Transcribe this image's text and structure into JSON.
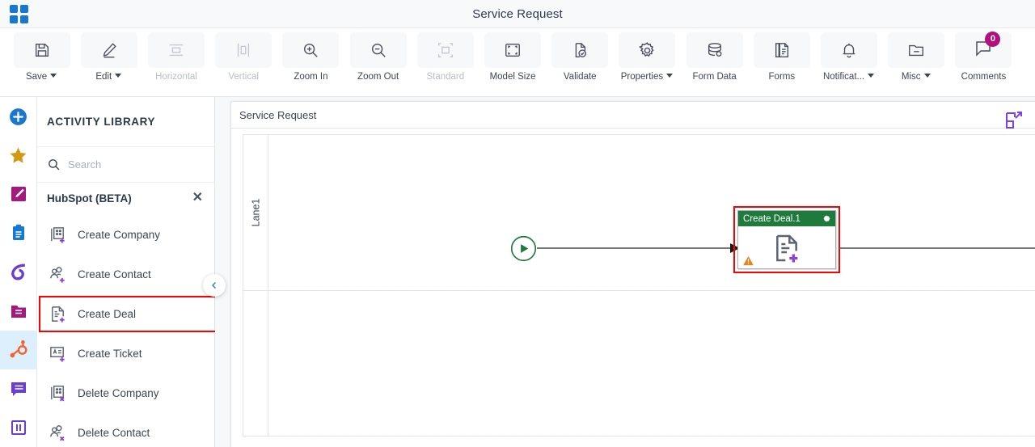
{
  "window": {
    "title": "Service Request",
    "logo_icon": "grid-apps-icon"
  },
  "toolbar": {
    "items": [
      {
        "label": "Save",
        "icon": "floppy-disk-icon",
        "has_dropdown": true,
        "disabled": false
      },
      {
        "label": "Edit",
        "icon": "pencil-icon",
        "has_dropdown": true,
        "disabled": false
      },
      {
        "label": "Horizontal",
        "icon": "horizontal-align-icon",
        "has_dropdown": false,
        "disabled": true
      },
      {
        "label": "Vertical",
        "icon": "vertical-align-icon",
        "has_dropdown": false,
        "disabled": true
      },
      {
        "label": "Zoom In",
        "icon": "magnifier-plus-icon",
        "has_dropdown": false,
        "disabled": false
      },
      {
        "label": "Zoom Out",
        "icon": "magnifier-minus-icon",
        "has_dropdown": false,
        "disabled": false
      },
      {
        "label": "Standard",
        "icon": "standard-size-icon",
        "has_dropdown": false,
        "disabled": true
      },
      {
        "label": "Model Size",
        "icon": "model-size-icon",
        "has_dropdown": false,
        "disabled": false
      },
      {
        "label": "Validate",
        "icon": "document-check-icon",
        "has_dropdown": false,
        "disabled": false
      },
      {
        "label": "Properties",
        "icon": "gear-icon",
        "has_dropdown": true,
        "disabled": false
      },
      {
        "label": "Form Data",
        "icon": "database-icon",
        "has_dropdown": false,
        "disabled": false
      },
      {
        "label": "Forms",
        "icon": "documents-icon",
        "has_dropdown": false,
        "disabled": false
      },
      {
        "label": "Notificat...",
        "icon": "bell-icon",
        "has_dropdown": true,
        "disabled": false
      },
      {
        "label": "Misc",
        "icon": "folder-minus-icon",
        "has_dropdown": true,
        "disabled": false
      }
    ],
    "comments": {
      "label": "Comments",
      "icon": "comment-bubble-icon",
      "badge_count": "0",
      "badge_color": "#b3107e"
    }
  },
  "rail": {
    "items": [
      {
        "name": "add",
        "icon": "plus-circle-icon",
        "color": "#1878ce",
        "active": false
      },
      {
        "name": "favorites",
        "icon": "star-icon",
        "color": "#d69812",
        "active": false
      },
      {
        "name": "authoring",
        "icon": "pencil-square-icon",
        "color": "#a5197f",
        "active": false
      },
      {
        "name": "clipboard",
        "icon": "clipboard-icon",
        "color": "#1878ce",
        "active": false
      },
      {
        "name": "integration",
        "icon": "swirl-icon",
        "color": "#6a3fd0",
        "active": false
      },
      {
        "name": "folder",
        "icon": "folder-icon",
        "color": "#a5197f",
        "active": false
      },
      {
        "name": "hubspot",
        "icon": "hubspot-icon",
        "color": "#f3622d",
        "active": true
      },
      {
        "name": "messaging",
        "icon": "chat-bubble-icon",
        "color": "#6a3fd0",
        "active": false
      },
      {
        "name": "columns",
        "icon": "columns-icon",
        "color": "#6a3fd0",
        "active": false
      }
    ]
  },
  "library": {
    "title": "ACTIVITY LIBRARY",
    "search": {
      "placeholder": "Search",
      "value": "",
      "icon": "search-icon"
    },
    "group": {
      "label": "HubSpot (BETA)",
      "close_icon": "close-icon"
    },
    "activities": [
      {
        "label": "Create Company",
        "icon": "create-company-icon",
        "selected": false
      },
      {
        "label": "Create Contact",
        "icon": "create-contact-icon",
        "selected": false
      },
      {
        "label": "Create Deal",
        "icon": "create-deal-icon",
        "selected": true
      },
      {
        "label": "Create Ticket",
        "icon": "create-ticket-icon",
        "selected": false
      },
      {
        "label": "Delete Company",
        "icon": "delete-company-icon",
        "selected": false
      },
      {
        "label": "Delete Contact",
        "icon": "delete-contact-icon",
        "selected": false
      }
    ],
    "collapse_icon": "chevron-left-icon",
    "highlight_color": "#ff0000"
  },
  "canvas": {
    "pool_title": "Service Request",
    "lane_label": "Lane1",
    "expand_icon": "expand-diagram-icon",
    "nodes": {
      "start": {
        "name": "start-event",
        "icon": "play-icon",
        "color": "#1e7b3c"
      },
      "task": {
        "title": "Create Deal.1",
        "header_color": "#1e7b3c",
        "gear_icon": "gear-icon",
        "body_icon": "create-deal-icon",
        "warning_icon": "warning-triangle-icon",
        "warning_color": "#e8821e",
        "selected": true,
        "selection_color": "#ff0000"
      },
      "end": {
        "name": "end-event",
        "icon": "stop-square-icon",
        "color": "#b01b1b"
      }
    }
  }
}
